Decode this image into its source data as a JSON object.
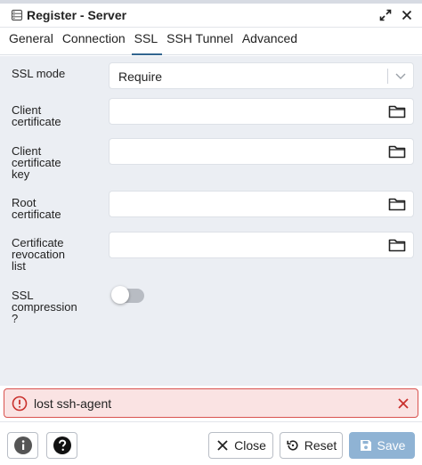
{
  "window": {
    "title": "Register - Server",
    "icon": "server-icon"
  },
  "tabs": [
    {
      "label": "General",
      "active": false
    },
    {
      "label": "Connection",
      "active": false
    },
    {
      "label": "SSL",
      "active": true
    },
    {
      "label": "SSH Tunnel",
      "active": false
    },
    {
      "label": "Advanced",
      "active": false
    }
  ],
  "form": {
    "ssl_mode": {
      "label": "SSL mode",
      "value": "Require"
    },
    "client_certificate": {
      "label_lines": [
        "Client",
        "certificate"
      ],
      "value": ""
    },
    "client_certificate_key": {
      "label_lines": [
        "Client",
        "certificate",
        "key"
      ],
      "value": ""
    },
    "root_certificate": {
      "label_lines": [
        "Root",
        "certificate"
      ],
      "value": ""
    },
    "certificate_revocation_list": {
      "label_lines": [
        "Certificate",
        "revocation",
        "list"
      ],
      "value": ""
    },
    "ssl_compression": {
      "label_lines": [
        "SSL",
        "compression",
        "?"
      ],
      "enabled": false
    }
  },
  "error": {
    "message": "lost ssh-agent",
    "color": "#d9534f"
  },
  "footer": {
    "close_label": "Close",
    "reset_label": "Reset",
    "save_label": "Save"
  },
  "colors": {
    "accent": "#326690",
    "save_disabled": "#8fb3d4",
    "panel_bg": "#ebeef3"
  }
}
